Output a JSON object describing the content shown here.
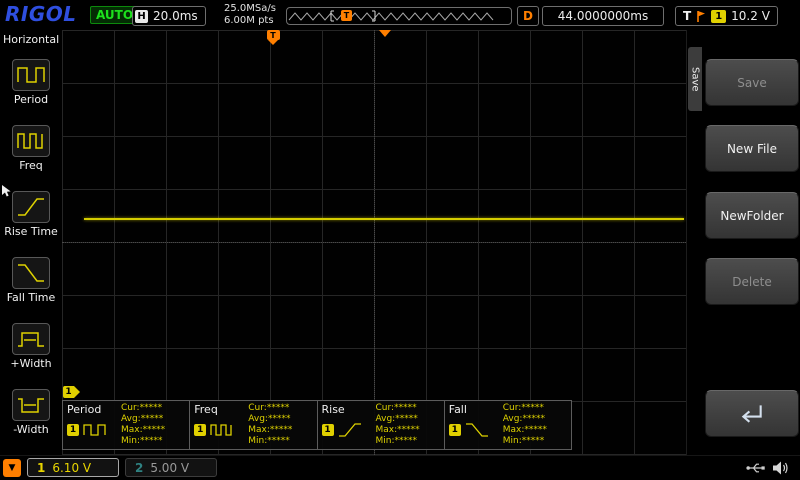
{
  "colors": {
    "ch1_yellow": "#e8d500",
    "ch2_dim_cyan": "#2f8282",
    "trigger_orange": "#ff7f00",
    "auto_green": "#1de01d",
    "logo_blue": "#2f4fe0",
    "trace_yellow": "#d4cc00",
    "grid_line": "#262626"
  },
  "top_bar": {
    "logo": "RIGOL",
    "status": "AUTO",
    "h_label": "H",
    "timebase": "20.0ms",
    "sample_rate": "25.0MSa/s",
    "memory_depth": "6.00M pts",
    "strip_trigger_label": "T",
    "d_label": "D",
    "delay_value": "44.0000000ms",
    "t_label": "T",
    "trigger_channel": "1",
    "trigger_level": "10.2 V"
  },
  "left_menu": {
    "title": "Horizontal",
    "items": [
      {
        "label": "Period"
      },
      {
        "label": "Freq"
      },
      {
        "label": "Rise Time",
        "selected": true
      },
      {
        "label": "Fall Time"
      },
      {
        "label": "+Width"
      },
      {
        "label": "-Width"
      }
    ]
  },
  "graticule": {
    "trigger_position_label": "T",
    "trigger_level_label": "T",
    "ch1_marker_label": "1",
    "ch1_trace": "flat horizontal line"
  },
  "measurements": [
    {
      "name": "Period",
      "channel": "1",
      "cur": "Cur:*****",
      "avg": "Avg:*****",
      "max": "Max:*****",
      "min": "Min:*****"
    },
    {
      "name": "Freq",
      "channel": "1",
      "cur": "Cur:*****",
      "avg": "Avg:*****",
      "max": "Max:*****",
      "min": "Min:*****"
    },
    {
      "name": "Rise",
      "channel": "1",
      "cur": "Cur:*****",
      "avg": "Avg:*****",
      "max": "Max:*****",
      "min": "Min:*****"
    },
    {
      "name": "Fall",
      "channel": "1",
      "cur": "Cur:*****",
      "avg": "Avg:*****",
      "max": "Max:*****",
      "min": "Min:*****"
    }
  ],
  "right_menu": {
    "tab": "Save",
    "buttons": [
      {
        "label": "Save",
        "enabled": false
      },
      {
        "label": "New File",
        "enabled": true
      },
      {
        "label": "NewFolder",
        "enabled": true
      },
      {
        "label": "Delete",
        "enabled": false
      },
      {
        "label": "",
        "enabled": true,
        "icon": "return-arrow"
      }
    ]
  },
  "bottom_bar": {
    "page_down_glyph": "▼",
    "ch1": {
      "label": "1",
      "value": "6.10 V"
    },
    "ch2": {
      "label": "2",
      "value": "5.00 V"
    }
  }
}
